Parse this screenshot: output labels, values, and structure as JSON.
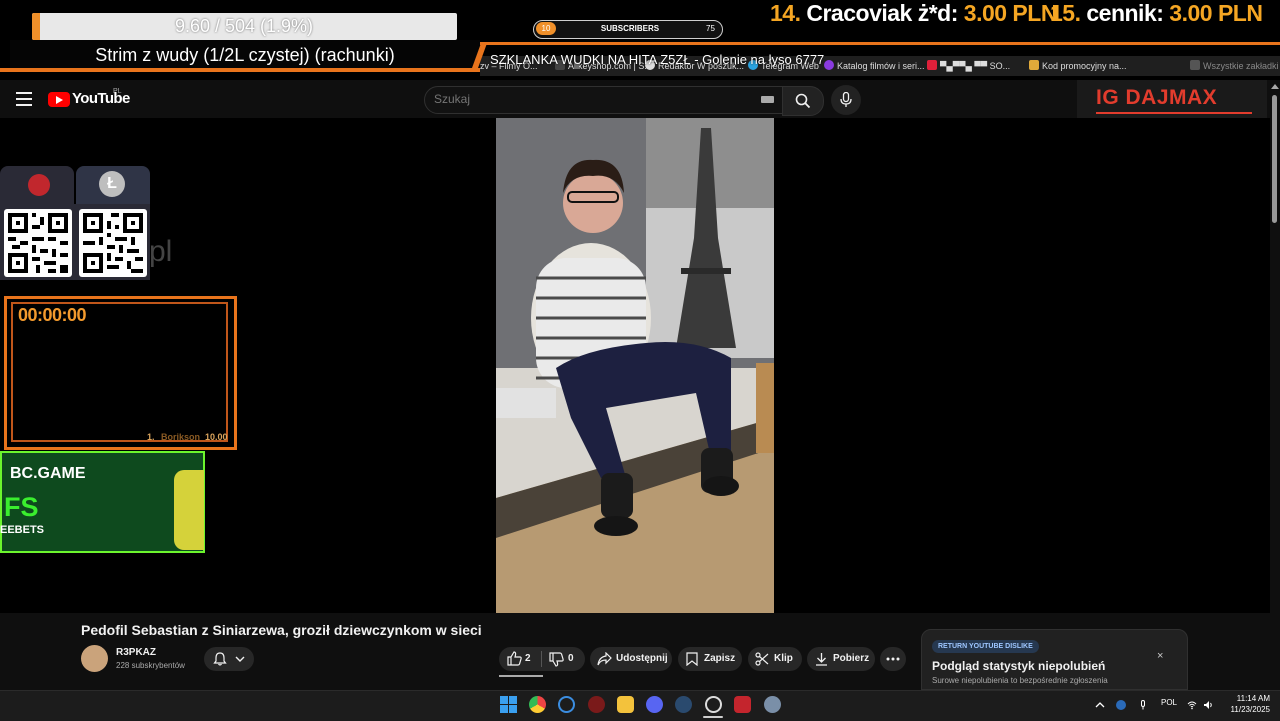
{
  "overlay": {
    "progress": {
      "text": "9.60 / 504 (1.9%)",
      "fraction": 0.019
    },
    "stream_title": "Strim z wudy (1/2L czystej) (rachunki)",
    "subscribers": {
      "count": "10",
      "label": "SUBSCRIBERS",
      "goal": "75",
      "fraction": 0.133
    },
    "ticker": "SZKLANKA WUDKI NA HITA Z5ZŁ - Golenie na łyso 6777",
    "leaderboard": [
      {
        "rank": "14.",
        "name": "Cracoviak ż*d:",
        "amount": "3.00 PLN"
      },
      {
        "rank": "15.",
        "name": "cennik:",
        "amount": "3.00 PLN"
      }
    ],
    "ig_handle": "IG DAJMAX",
    "ghost_text": "pl",
    "timer": {
      "time": "00:00:00",
      "rank": "1.",
      "player": "Borikson",
      "score": "10.00"
    },
    "bc_banner": {
      "logo": "BC.GAME",
      "headline": "FS",
      "sub": "EEBETS"
    },
    "crypto": {
      "coin_1_icon": "tron-icon",
      "coin_2_icon": "litecoin-icon",
      "coin_2_symbol": "Ł"
    }
  },
  "browser": {
    "bookmarks": [
      "zv – Filmy O...",
      "Allkeyshop.com | S...",
      "Redaktor W poszuk...",
      "Telegram Web",
      "Katalog filmów i seri...",
      "▀▄▀▀▄ ▀▀ SO...",
      "Kod promocyjny na...",
      "Wszystkie zakładki"
    ]
  },
  "youtube": {
    "logo_text": "YouTube",
    "country": "PL",
    "search_placeholder": "Szukaj",
    "video_title": "Pedofil Sebastian z Siniarzewa, groził dziewczynkom w sieci",
    "channel": {
      "name": "R3PKAZ",
      "subscribers": "228 subskrybentów"
    },
    "actions": {
      "likes": "2",
      "dislikes": "0",
      "share": "Udostępnij",
      "save": "Zapisz",
      "clip": "Klip",
      "download": "Pobierz"
    },
    "ryd_panel": {
      "tag": "RETURN YOUTUBE DISLIKE",
      "title": "Podgląd statystyk niepolubień",
      "body": "Surowe niepolubienia to bezpośrednie zgłoszenia",
      "close": "×"
    }
  },
  "taskbar": {
    "language": "POL",
    "time": "11:14 AM",
    "date": "11/23/2025",
    "apps": [
      "windows-icon",
      "chrome-icon",
      "ccleaner-icon",
      "app-icon",
      "file-explorer-icon",
      "discord-icon",
      "steam-icon",
      "obs-icon",
      "news-icon",
      "settings-icon"
    ]
  },
  "colors": {
    "accent_orange": "#e8741c",
    "gold": "#f5a623",
    "youtube_red": "#ff0000",
    "ig_red": "#e23c2d",
    "bc_green": "#3aee2e"
  }
}
